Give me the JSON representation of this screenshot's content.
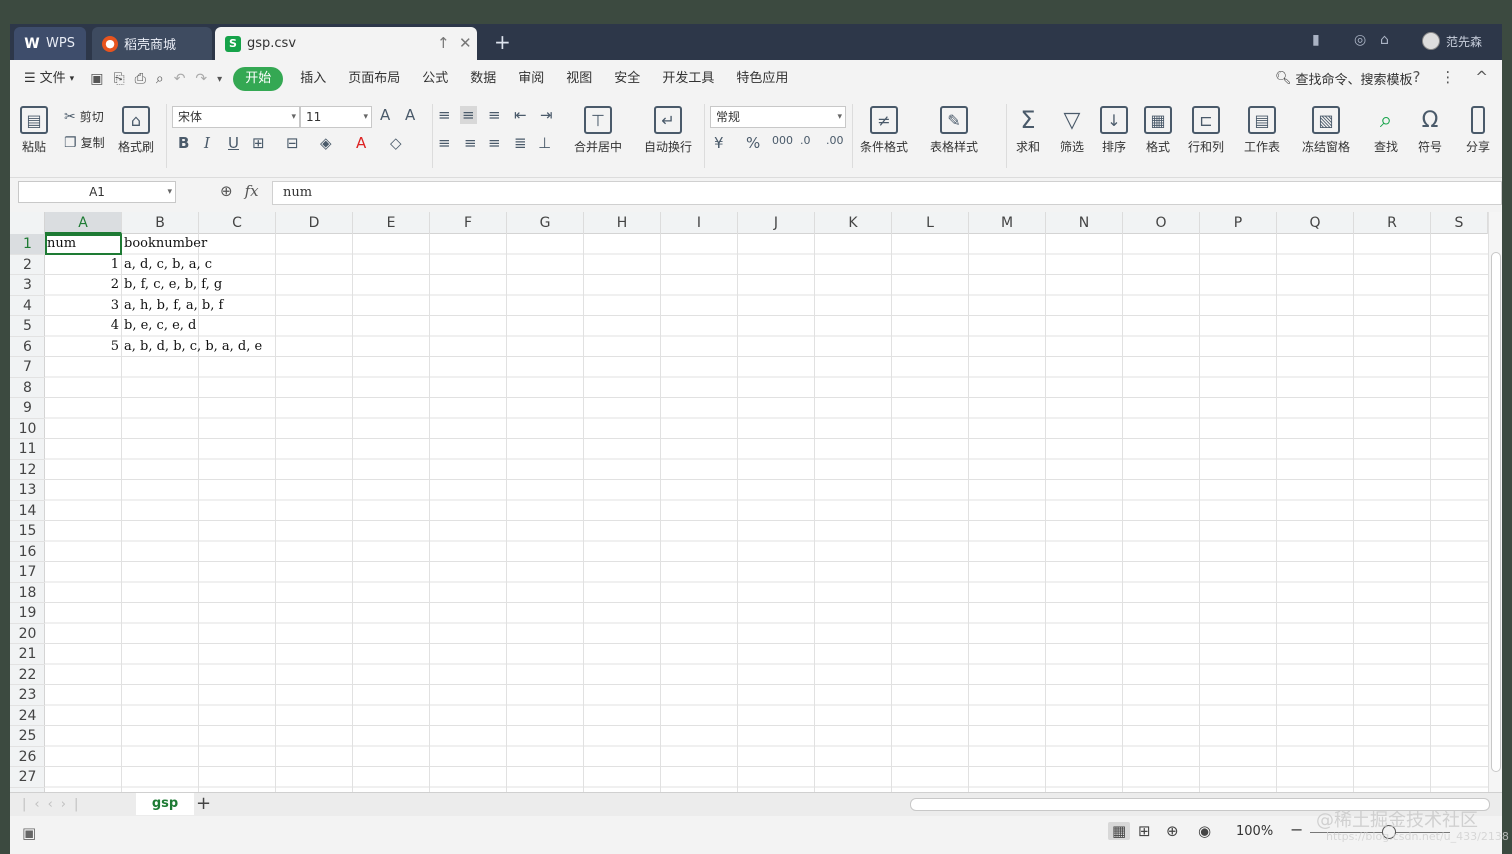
{
  "tabs": {
    "wps": "WPS",
    "store": "稻壳商城",
    "file": "gsp.csv"
  },
  "user": {
    "name": "范先森"
  },
  "menu": {
    "file": "文件",
    "items": [
      "开始",
      "插入",
      "页面布局",
      "公式",
      "数据",
      "审阅",
      "视图",
      "安全",
      "开发工具",
      "特色应用"
    ],
    "search": "查找命令、搜索模板"
  },
  "ribbon": {
    "paste": "粘贴",
    "cut": "剪切",
    "copy": "复制",
    "format_painter": "格式刷",
    "font_name": "宋体",
    "font_size": "11",
    "merge_center": "合并居中",
    "wrap_text": "自动换行",
    "number_format": "常规",
    "conditional_format": "条件格式",
    "table_style": "表格样式",
    "sum": "求和",
    "filter": "筛选",
    "sort": "排序",
    "format": "格式",
    "row_col": "行和列",
    "worksheet": "工作表",
    "freeze": "冻结窗格",
    "find": "查找",
    "symbol": "符号",
    "split": "分享"
  },
  "formula_bar": {
    "name_box": "A1",
    "fx": "fx",
    "content": "num"
  },
  "columns": [
    "A",
    "B",
    "C",
    "D",
    "E",
    "F",
    "G",
    "H",
    "I",
    "J",
    "K",
    "L",
    "M",
    "N",
    "O",
    "P",
    "Q",
    "R",
    "S"
  ],
  "rows": [
    "1",
    "2",
    "3",
    "4",
    "5",
    "6",
    "7",
    "8",
    "9",
    "10",
    "11",
    "12",
    "13",
    "14",
    "15",
    "16",
    "17",
    "18",
    "19",
    "20",
    "21",
    "22",
    "23",
    "24",
    "25",
    "26",
    "27"
  ],
  "cells": {
    "a1": "num",
    "b1": "booknumber",
    "a2": "1",
    "b2": "a, d, c, b, a, c",
    "a3": "2",
    "b3": "b, f, c, e, b, f, g",
    "a4": "3",
    "b4": "a, h, b, f, a, b, f",
    "a5": "4",
    "b5": "b, e, c, e, d",
    "a6": "5",
    "b6": "a, b, d, b, c, b, a, d, e"
  },
  "sheet": {
    "name": "gsp"
  },
  "status": {
    "zoom": "100%"
  },
  "watermark": {
    "text": "@稀土掘金技术社区",
    "sub": "https://blog.csdn.net/u_433/2138"
  }
}
